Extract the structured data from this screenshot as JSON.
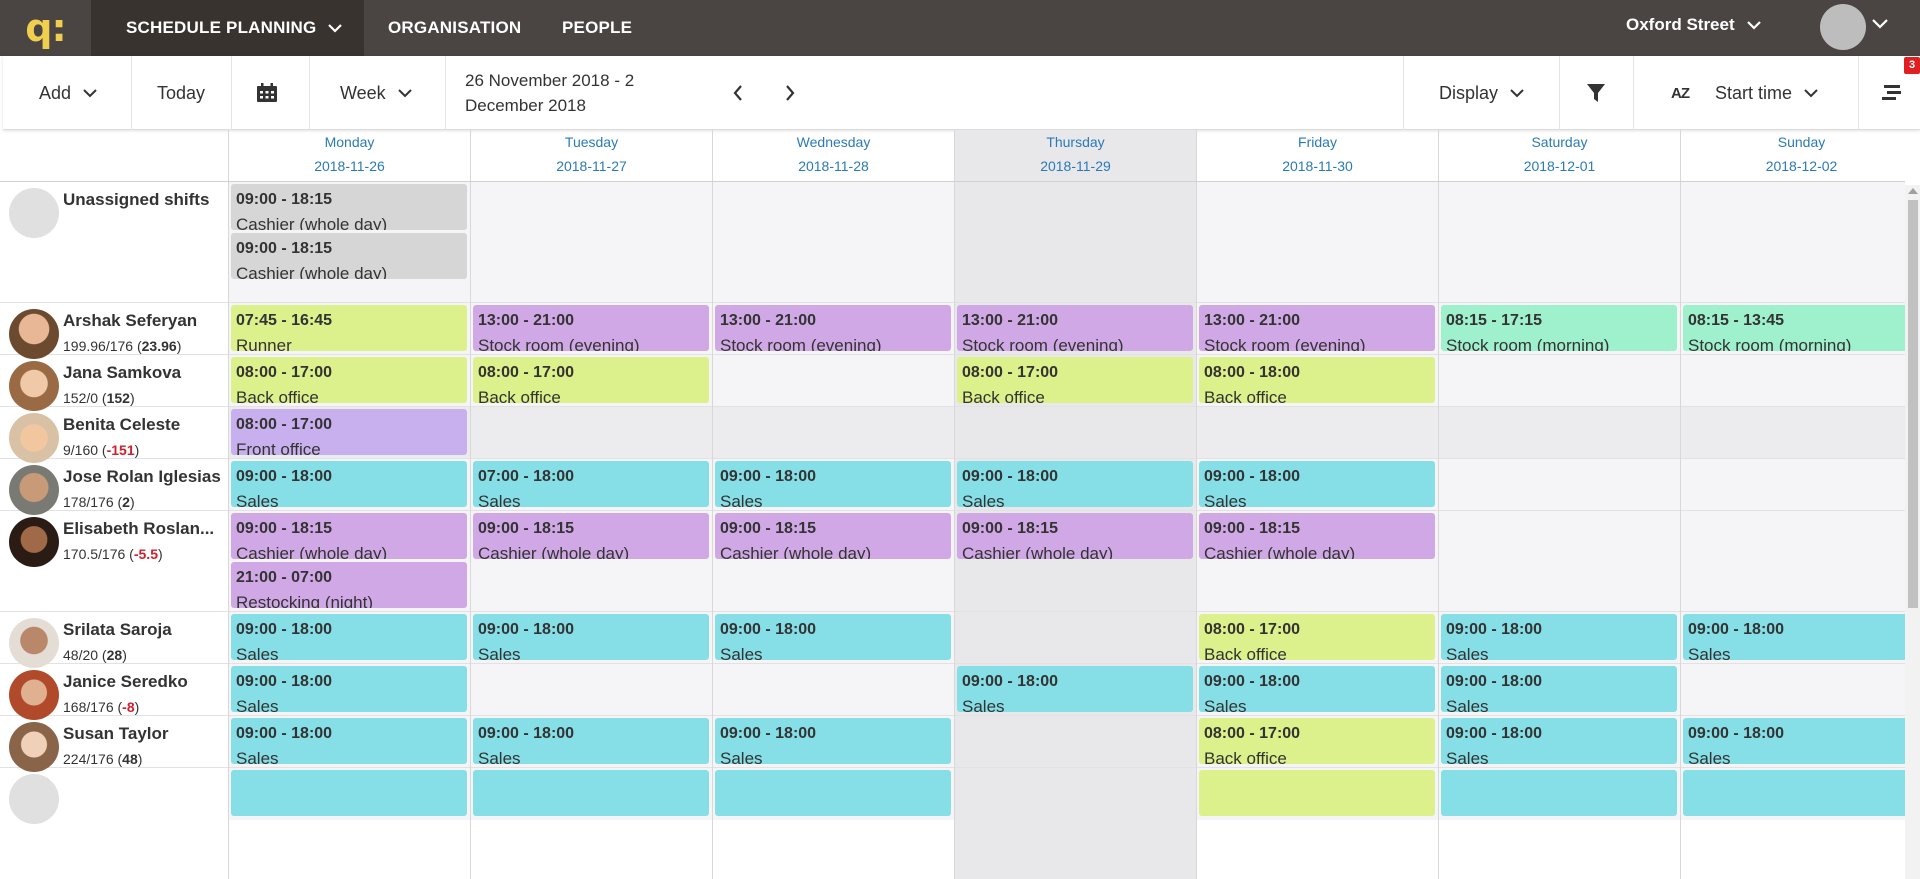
{
  "nav": {
    "logo": "q:",
    "items": [
      {
        "label": "SCHEDULE PLANNING",
        "active": true
      },
      {
        "label": "ORGANISATION",
        "active": false
      },
      {
        "label": "PEOPLE",
        "active": false
      }
    ],
    "location": "Oxford Street"
  },
  "toolbar": {
    "add_label": "Add",
    "today_label": "Today",
    "view_label": "Week",
    "date_range": "26 November 2018 - 2 December 2018",
    "display_label": "Display",
    "sort_label": "Start time",
    "sort_icon_text": "AZ",
    "notification_count": "3"
  },
  "days": [
    {
      "name": "Monday",
      "date": "2018-11-26"
    },
    {
      "name": "Tuesday",
      "date": "2018-11-27"
    },
    {
      "name": "Wednesday",
      "date": "2018-11-28"
    },
    {
      "name": "Thursday",
      "date": "2018-11-29"
    },
    {
      "name": "Friday",
      "date": "2018-11-30"
    },
    {
      "name": "Saturday",
      "date": "2018-12-01"
    },
    {
      "name": "Sunday",
      "date": "2018-12-02"
    }
  ],
  "colors": {
    "gray": "#d6d6d6",
    "lime": "#dcf08c",
    "purple": "#d0a8e6",
    "mint": "#9ff0cd",
    "lavender": "#c8b0ee",
    "cyan": "#86dfe6",
    "accent": "#2a7ab8",
    "negative": "#d0202a"
  },
  "rows": [
    {
      "name": "Unassigned shifts",
      "hours": "",
      "balance": "",
      "negative": false,
      "shifts": [
        {
          "day": 0,
          "slot": 0,
          "time": "09:00 - 18:15",
          "role": "Cashier (whole day)",
          "color": "gray"
        },
        {
          "day": 0,
          "slot": 1,
          "time": "09:00 - 18:15",
          "role": "Cashier (whole day)",
          "color": "gray"
        }
      ]
    },
    {
      "name": "Arshak Seferyan",
      "hours": "199.96/176",
      "balance": "23.96",
      "negative": false,
      "shifts": [
        {
          "day": 0,
          "slot": 0,
          "time": "07:45 - 16:45",
          "role": "Runner",
          "color": "lime"
        },
        {
          "day": 1,
          "slot": 0,
          "time": "13:00 - 21:00",
          "role": "Stock room (evening)",
          "color": "purple"
        },
        {
          "day": 2,
          "slot": 0,
          "time": "13:00 - 21:00",
          "role": "Stock room (evening)",
          "color": "purple"
        },
        {
          "day": 3,
          "slot": 0,
          "time": "13:00 - 21:00",
          "role": "Stock room (evening)",
          "color": "purple"
        },
        {
          "day": 4,
          "slot": 0,
          "time": "13:00 - 21:00",
          "role": "Stock room (evening)",
          "color": "purple"
        },
        {
          "day": 5,
          "slot": 0,
          "time": "08:15 - 17:15",
          "role": "Stock room (morning)",
          "color": "mint"
        },
        {
          "day": 6,
          "slot": 0,
          "time": "08:15 - 13:45",
          "role": "Stock room (morning)",
          "color": "mint"
        }
      ]
    },
    {
      "name": "Jana Samkova",
      "hours": "152/0",
      "balance": "152",
      "negative": false,
      "shifts": [
        {
          "day": 0,
          "slot": 0,
          "time": "08:00 - 17:00",
          "role": "Back office",
          "color": "lime"
        },
        {
          "day": 1,
          "slot": 0,
          "time": "08:00 - 17:00",
          "role": "Back office",
          "color": "lime"
        },
        {
          "day": 3,
          "slot": 0,
          "time": "08:00 - 17:00",
          "role": "Back office",
          "color": "lime"
        },
        {
          "day": 4,
          "slot": 0,
          "time": "08:00 - 18:00",
          "role": "Back office",
          "color": "lime"
        }
      ]
    },
    {
      "name": "Benita Celeste",
      "hours": "9/160",
      "balance": "-151",
      "negative": true,
      "shifts": [
        {
          "day": 0,
          "slot": 0,
          "time": "08:00 - 17:00",
          "role": "Front office",
          "color": "lavender"
        }
      ]
    },
    {
      "name": "Jose Rolan Iglesias",
      "hours": "178/176",
      "balance": "2",
      "negative": false,
      "shifts": [
        {
          "day": 0,
          "slot": 0,
          "time": "09:00 - 18:00",
          "role": "Sales",
          "color": "cyan"
        },
        {
          "day": 1,
          "slot": 0,
          "time": "07:00 - 18:00",
          "role": "Sales",
          "color": "cyan"
        },
        {
          "day": 2,
          "slot": 0,
          "time": "09:00 - 18:00",
          "role": "Sales",
          "color": "cyan"
        },
        {
          "day": 3,
          "slot": 0,
          "time": "09:00 - 18:00",
          "role": "Sales",
          "color": "cyan"
        },
        {
          "day": 4,
          "slot": 0,
          "time": "09:00 - 18:00",
          "role": "Sales",
          "color": "cyan"
        }
      ]
    },
    {
      "name": "Elisabeth Roslan...",
      "hours": "170.5/176",
      "balance": "-5.5",
      "negative": true,
      "shifts": [
        {
          "day": 0,
          "slot": 0,
          "time": "09:00 - 18:15",
          "role": "Cashier (whole day)",
          "color": "purple"
        },
        {
          "day": 0,
          "slot": 1,
          "time": "21:00 - 07:00",
          "role": "Restocking (night)",
          "color": "purple"
        },
        {
          "day": 1,
          "slot": 0,
          "time": "09:00 - 18:15",
          "role": "Cashier (whole day)",
          "color": "purple"
        },
        {
          "day": 2,
          "slot": 0,
          "time": "09:00 - 18:15",
          "role": "Cashier (whole day)",
          "color": "purple"
        },
        {
          "day": 3,
          "slot": 0,
          "time": "09:00 - 18:15",
          "role": "Cashier (whole day)",
          "color": "purple"
        },
        {
          "day": 4,
          "slot": 0,
          "time": "09:00 - 18:15",
          "role": "Cashier (whole day)",
          "color": "purple"
        }
      ]
    },
    {
      "name": "Srilata Saroja",
      "hours": "48/20",
      "balance": "28",
      "negative": false,
      "shifts": [
        {
          "day": 0,
          "slot": 0,
          "time": "09:00 - 18:00",
          "role": "Sales",
          "color": "cyan"
        },
        {
          "day": 1,
          "slot": 0,
          "time": "09:00 - 18:00",
          "role": "Sales",
          "color": "cyan"
        },
        {
          "day": 2,
          "slot": 0,
          "time": "09:00 - 18:00",
          "role": "Sales",
          "color": "cyan"
        },
        {
          "day": 4,
          "slot": 0,
          "time": "08:00 - 17:00",
          "role": "Back office",
          "color": "lime"
        },
        {
          "day": 5,
          "slot": 0,
          "time": "09:00 - 18:00",
          "role": "Sales",
          "color": "cyan"
        },
        {
          "day": 6,
          "slot": 0,
          "time": "09:00 - 18:00",
          "role": "Sales",
          "color": "cyan"
        }
      ]
    },
    {
      "name": "Janice Seredko",
      "hours": "168/176",
      "balance": "-8",
      "negative": true,
      "shifts": [
        {
          "day": 0,
          "slot": 0,
          "time": "09:00 - 18:00",
          "role": "Sales",
          "color": "cyan"
        },
        {
          "day": 3,
          "slot": 0,
          "time": "09:00 - 18:00",
          "role": "Sales",
          "color": "cyan"
        },
        {
          "day": 4,
          "slot": 0,
          "time": "09:00 - 18:00",
          "role": "Sales",
          "color": "cyan"
        },
        {
          "day": 5,
          "slot": 0,
          "time": "09:00 - 18:00",
          "role": "Sales",
          "color": "cyan"
        }
      ]
    },
    {
      "name": "Susan Taylor",
      "hours": "224/176",
      "balance": "48",
      "negative": false,
      "shifts": [
        {
          "day": 0,
          "slot": 0,
          "time": "09:00 - 18:00",
          "role": "Sales",
          "color": "cyan"
        },
        {
          "day": 1,
          "slot": 0,
          "time": "09:00 - 18:00",
          "role": "Sales",
          "color": "cyan"
        },
        {
          "day": 2,
          "slot": 0,
          "time": "09:00 - 18:00",
          "role": "Sales",
          "color": "cyan"
        },
        {
          "day": 4,
          "slot": 0,
          "time": "08:00 - 17:00",
          "role": "Back office",
          "color": "lime"
        },
        {
          "day": 5,
          "slot": 0,
          "time": "09:00 - 18:00",
          "role": "Sales",
          "color": "cyan"
        },
        {
          "day": 6,
          "slot": 0,
          "time": "09:00 - 18:00",
          "role": "Sales",
          "color": "cyan"
        }
      ]
    },
    {
      "name": "",
      "hours": "",
      "balance": "",
      "negative": false,
      "shifts": [
        {
          "day": 0,
          "slot": 0,
          "time": "",
          "role": "",
          "color": "cyan"
        },
        {
          "day": 1,
          "slot": 0,
          "time": "",
          "role": "",
          "color": "cyan"
        },
        {
          "day": 2,
          "slot": 0,
          "time": "",
          "role": "",
          "color": "cyan"
        },
        {
          "day": 4,
          "slot": 0,
          "time": "",
          "role": "",
          "color": "lime"
        },
        {
          "day": 5,
          "slot": 0,
          "time": "",
          "role": "",
          "color": "cyan"
        },
        {
          "day": 6,
          "slot": 0,
          "time": "",
          "role": "",
          "color": "cyan"
        }
      ]
    }
  ]
}
